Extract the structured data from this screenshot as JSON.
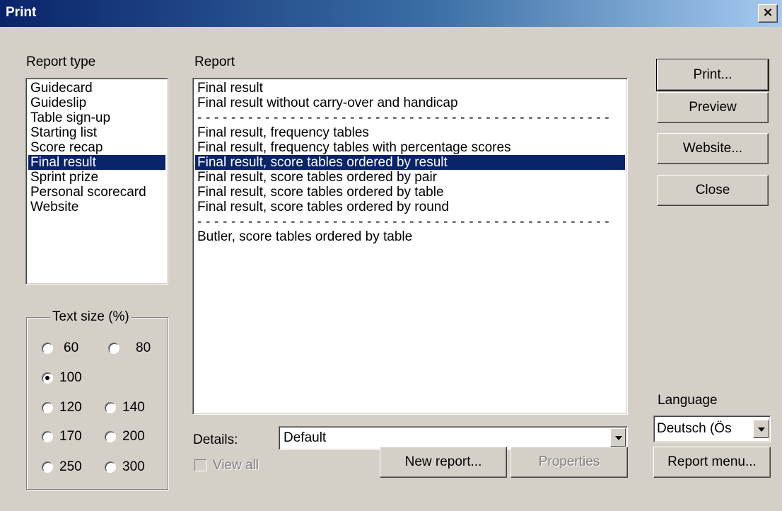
{
  "window": {
    "title": "Print",
    "close_label": "×"
  },
  "report_type": {
    "label": "Report type",
    "items": [
      "Guidecard",
      "Guideslip",
      "Table sign-up",
      "Starting list",
      "Score recap",
      "Final result",
      "Sprint prize",
      "Personal scorecard",
      "Website"
    ],
    "selected": "Final result"
  },
  "report": {
    "label": "Report",
    "items": [
      "Final result",
      "Final result without carry-over and handicap",
      "- - - - - - - - - - - - - - - - - - - - - - - - - - - - - - - - - - - - - - - - - - - - - - - - -",
      "Final result, frequency tables",
      "Final result, frequency tables with percentage scores",
      "Final result, score tables ordered by result",
      "Final result, score tables ordered by pair",
      "Final result, score tables ordered by table",
      "Final result, score tables ordered by round",
      "- - - - - - - - - - - - - - - - - - - - - - - - - - - - - - - - - - - - - - - - - - - - - - - - -",
      "Butler, score tables ordered by table"
    ],
    "selected": "Final result, score tables ordered by result"
  },
  "text_size": {
    "label": "Text size (%)",
    "options": [
      "60",
      "80",
      "100",
      "120",
      "140",
      "170",
      "200",
      "250",
      "300"
    ],
    "selected": "100"
  },
  "details": {
    "label": "Details:",
    "value": "Default"
  },
  "view_all": {
    "label": "View all",
    "checked": false,
    "enabled": false
  },
  "buttons": {
    "print": "Print...",
    "preview": "Preview",
    "website": "Website...",
    "close": "Close",
    "new_report": "New report...",
    "properties": "Properties",
    "report_menu": "Report menu..."
  },
  "language": {
    "label": "Language",
    "value": "Deutsch (Ös"
  },
  "colors": {
    "selection": "#0a246a",
    "face": "#d4d0c8",
    "title_start": "#0a246a",
    "title_end": "#a6caf0"
  }
}
